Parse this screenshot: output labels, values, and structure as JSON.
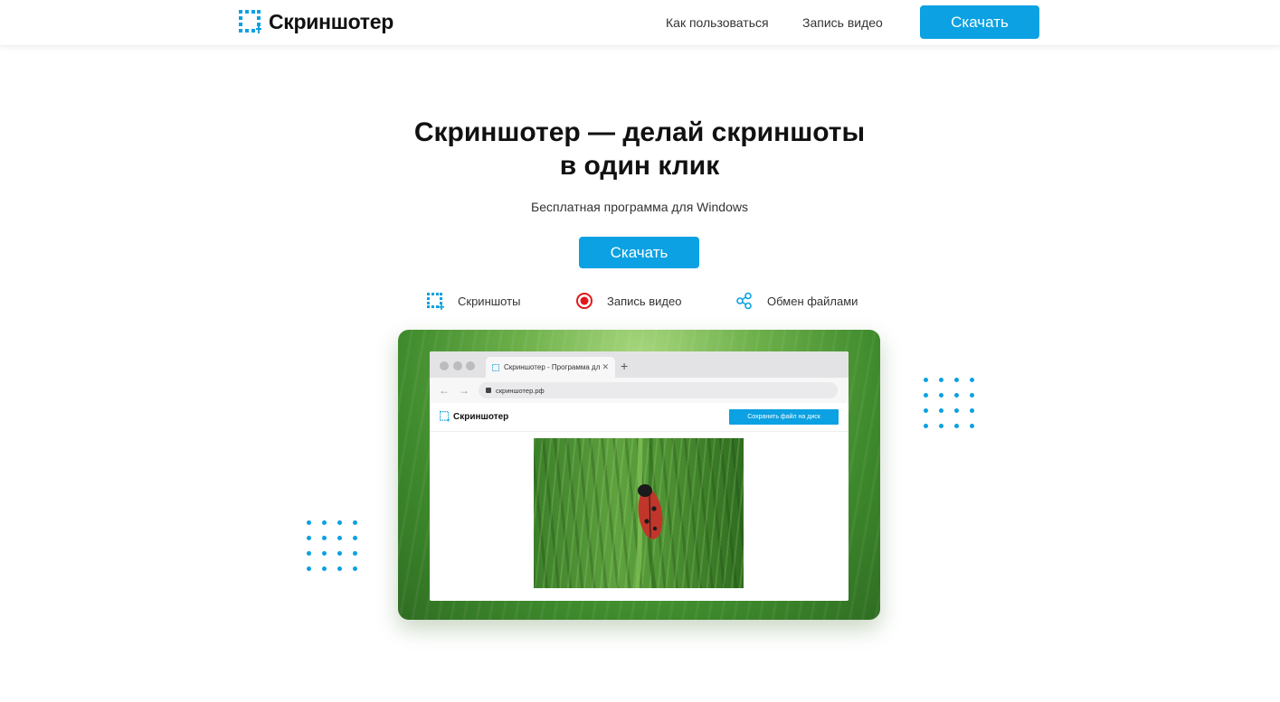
{
  "header": {
    "logo_text": "Скриншотер",
    "nav": [
      {
        "label": "Как пользоваться"
      },
      {
        "label": "Запись видео"
      }
    ],
    "download_label": "Скачать"
  },
  "hero": {
    "title_line1": "Скриншотер — делай скриншоты",
    "title_line2": "в один клик",
    "subtitle": "Бесплатная программа для Windows",
    "download_label": "Скачать"
  },
  "features": [
    {
      "label": "Скриншоты",
      "icon": "screenshot-frame-icon"
    },
    {
      "label": "Запись видео",
      "icon": "record-icon"
    },
    {
      "label": "Обмен файлами",
      "icon": "share-icon"
    }
  ],
  "mock_browser": {
    "tab_title": "Скриншотер - Программа дл",
    "url": "скриншотер.рф",
    "app_logo_text": "Скриншотер",
    "save_button_label": "Сохранить файл на диск"
  },
  "colors": {
    "accent": "#0ba1e2",
    "record": "#e0181b",
    "text": "#111111"
  }
}
